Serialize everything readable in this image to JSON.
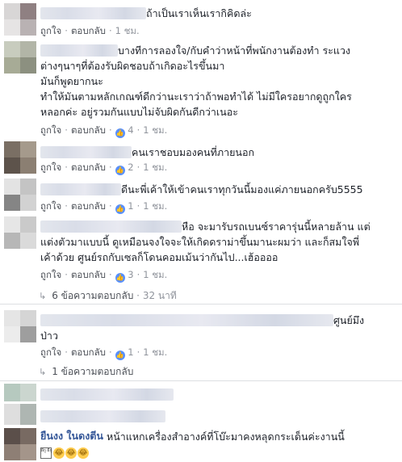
{
  "colors": {
    "link": "#365899",
    "meta": "#90949c",
    "action": "#4b4f56",
    "like": "#5890ff",
    "divider": "#dddfe2"
  },
  "action_labels": {
    "like": "ถูกใจ",
    "reply": "ตอบกลับ"
  },
  "comments": [
    {
      "lines": [
        "ถ้าเป็นเราเห็นเรากิคิดล่ะ"
      ],
      "time": "1 ชม.",
      "likes": ""
    },
    {
      "lines": [
        "บางทีการลองใจ/กับคำว่าหน้าที่พนักงานต้องทำ ระแวง",
        "ต่างๆนาๆที่ต้องรับผิดชอบถ้าเกิดอะไรขึ้นมา",
        "มันก็พูดยากนะ",
        "ทำให้มันตามหลักเกณฑ์ดีกว่านะเราว่าถ้าพอทำได้ ไม่มีใครอยากดูถูกใคร",
        "หลอกค่ะ อยู่รวมกันแบบไม่จับผิดกันดีกว่าเนอะ"
      ],
      "time": "1 ชม.",
      "likes": "4"
    },
    {
      "lines": [
        "คนเราชอบมองคนที่ภายนอก"
      ],
      "time": "1 ชม.",
      "likes": "2"
    },
    {
      "lines": [
        "ดีนะพี่เค้าให้เข้าคนเราทุกวันนี้มองแค่ภายนอกครับ5555"
      ],
      "time": "1 ชม.",
      "likes": "1"
    },
    {
      "lines": [
        "หือ จะมารับรถเบนซ์ราคารุ่นนี้หลายล้าน แต่",
        "แต่งตัวมาแบบนี้ ดูเหมือนจงใจจะให้เกิดดราม่าขึ้นมานะผมว่า และก็สมใจพี่",
        "เค้าด้วย ศูนย์รถกับเซลก็โดนคอมเม้นว่ากันไป...เฮ้ออออ"
      ],
      "time": "1 ชม.",
      "likes": "3"
    },
    {
      "lines": [
        "ศูนย์มึง",
        "ป่าว"
      ],
      "time": "1 ชม.",
      "likes": "1"
    },
    {
      "name": "ยืนงง ในดงตีน",
      "lines": [
        "หน้าแหกเครื่องสำอางค์ที่โบ๊ะมาคงหลุดกระเด็นค่ะงานนี้"
      ],
      "sticker": "ผีกู ผีกู"
    }
  ],
  "reply_links": [
    {
      "label": "6 ข้อความตอบกลับ",
      "time": "32 นาที"
    },
    {
      "label": "1 ข้อความตอบกลับ",
      "time": ""
    }
  ]
}
